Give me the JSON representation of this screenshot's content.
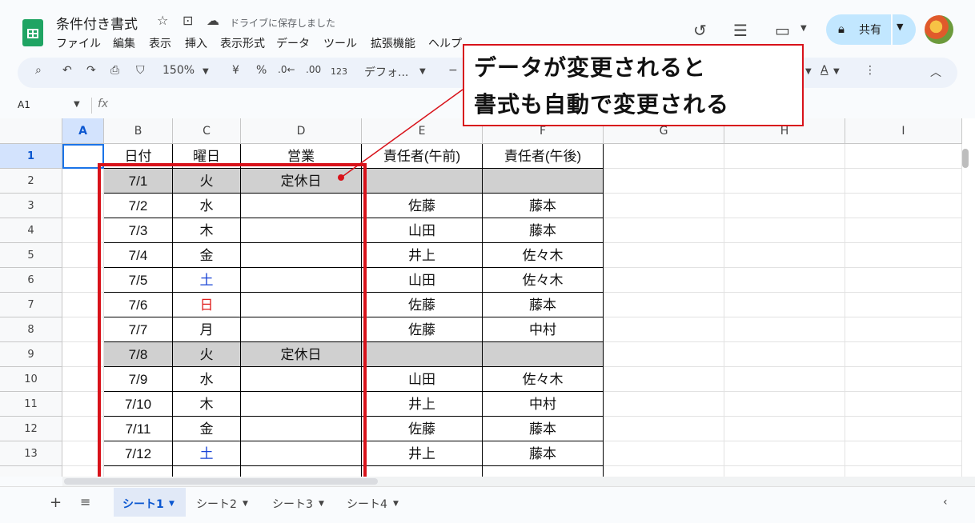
{
  "doc": {
    "title": "条件付き書式",
    "saved_status": "ドライブに保存しました",
    "menu": [
      "ファイル",
      "編集",
      "表示",
      "挿入",
      "表示形式",
      "データ",
      "ツール",
      "拡張機能",
      "ヘルプ"
    ]
  },
  "share": {
    "label": "共有"
  },
  "toolbar": {
    "zoom": "150%",
    "currency": "¥",
    "percent": "%",
    "dec_decrease": ".0←",
    "dec_increase": ".00",
    "number_format": "123",
    "font": "デフォ...",
    "minus": "−"
  },
  "formula_bar": {
    "name_box": "A1",
    "fx": "fx"
  },
  "columns": [
    "A",
    "B",
    "C",
    "D",
    "E",
    "F",
    "G",
    "H",
    "I"
  ],
  "row_numbers": [
    "1",
    "2",
    "3",
    "4",
    "5",
    "6",
    "7",
    "8",
    "9",
    "10",
    "11",
    "12",
    "13"
  ],
  "header_row": [
    "日付",
    "曜日",
    "営業",
    "責任者(午前)",
    "責任者(午後)"
  ],
  "rows": [
    [
      "7/1",
      "火",
      "定休日",
      "",
      ""
    ],
    [
      "7/2",
      "水",
      "",
      "佐藤",
      "藤本"
    ],
    [
      "7/3",
      "木",
      "",
      "山田",
      "藤本"
    ],
    [
      "7/4",
      "金",
      "",
      "井上",
      "佐々木"
    ],
    [
      "7/5",
      "土",
      "",
      "山田",
      "佐々木"
    ],
    [
      "7/6",
      "日",
      "",
      "佐藤",
      "藤本"
    ],
    [
      "7/7",
      "月",
      "",
      "佐藤",
      "中村"
    ],
    [
      "7/8",
      "火",
      "定休日",
      "",
      ""
    ],
    [
      "7/9",
      "水",
      "",
      "山田",
      "佐々木"
    ],
    [
      "7/10",
      "木",
      "",
      "井上",
      "中村"
    ],
    [
      "7/11",
      "金",
      "",
      "佐藤",
      "藤本"
    ],
    [
      "7/12",
      "土",
      "",
      "井上",
      "藤本"
    ]
  ],
  "colors": {
    "saturday": "#1a44d6",
    "sunday": "#e0201e",
    "holiday_fill": "#d0d0d0",
    "callout_red": "#d8121a",
    "accent_green": "#1fa463"
  },
  "callout": {
    "line1": "データが変更されると",
    "line2": "書式も自動で変更される"
  },
  "sheets": [
    "シート1",
    "シート2",
    "シート3",
    "シート4"
  ]
}
